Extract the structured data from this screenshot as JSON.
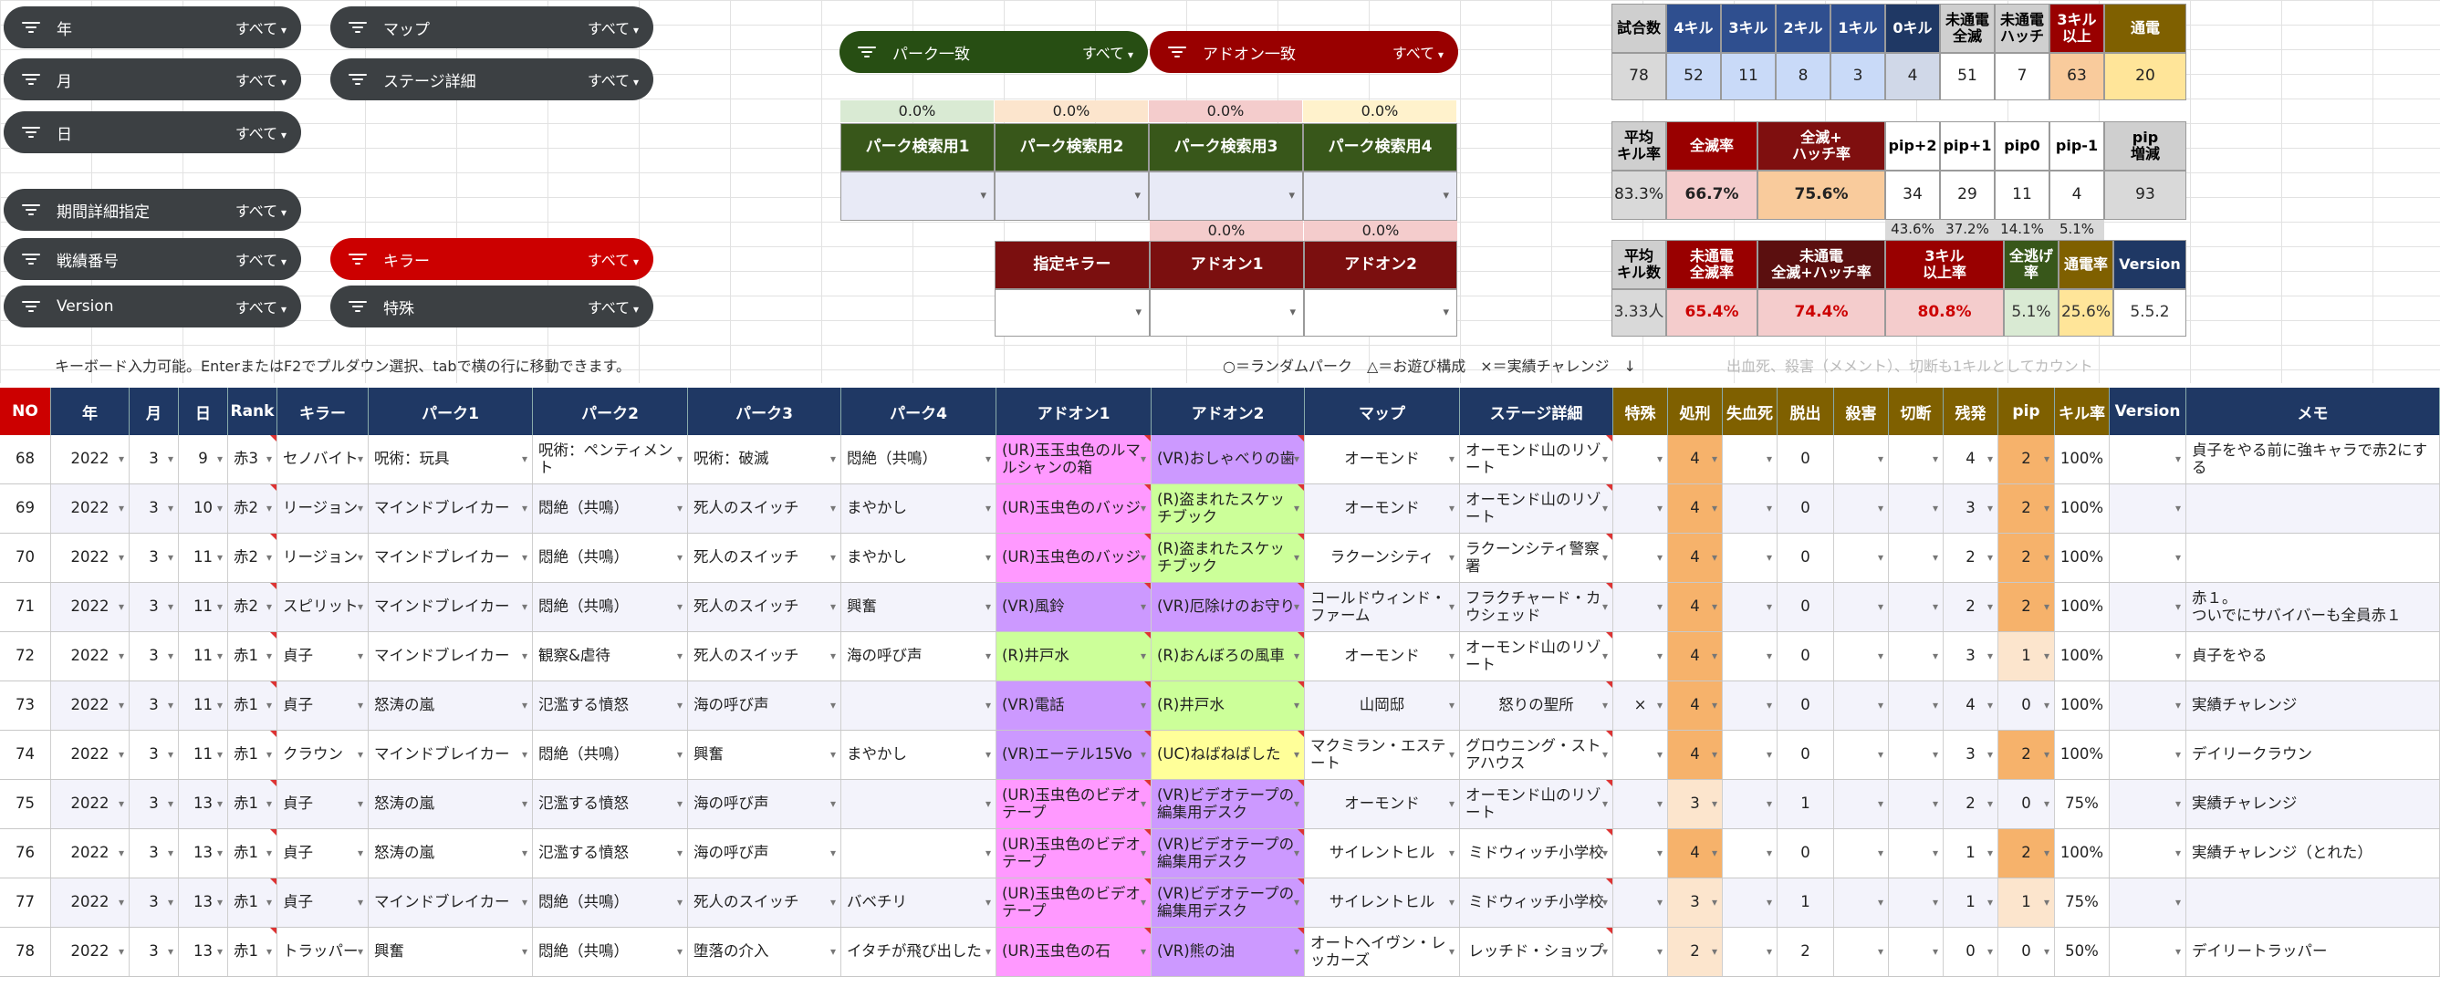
{
  "filters": {
    "year": {
      "label": "年",
      "value": "すべて"
    },
    "month": {
      "label": "月",
      "value": "すべて"
    },
    "day": {
      "label": "日",
      "value": "すべて"
    },
    "period": {
      "label": "期間詳細指定",
      "value": "すべて"
    },
    "record_no": {
      "label": "戦績番号",
      "value": "すべて"
    },
    "version": {
      "label": "Version",
      "value": "すべて"
    },
    "map": {
      "label": "マップ",
      "value": "すべて"
    },
    "stage": {
      "label": "ステージ詳細",
      "value": "すべて"
    },
    "killer": {
      "label": "キラー",
      "value": "すべて"
    },
    "special": {
      "label": "特殊",
      "value": "すべて"
    },
    "perk_match": {
      "label": "パーク一致",
      "value": "すべて"
    },
    "addon_match": {
      "label": "アドオン一致",
      "value": "すべて"
    }
  },
  "perk_search": {
    "percents": [
      "0.0%",
      "0.0%",
      "0.0%",
      "0.0%"
    ],
    "headers": [
      "パーク検索用1",
      "パーク検索用2",
      "パーク検索用3",
      "パーク検索用4"
    ],
    "addon_percents": [
      "0.0%",
      "0.0%"
    ],
    "killer_headers": [
      "指定キラー",
      "アドオン1",
      "アドオン2"
    ]
  },
  "stats1": {
    "headers": [
      "試合数",
      "4キル",
      "3キル",
      "2キル",
      "1キル",
      "0キル",
      "未通電\n全滅",
      "未通電\nハッチ",
      "3キル\n以上",
      "通電"
    ],
    "values": [
      "78",
      "52",
      "11",
      "8",
      "3",
      "4",
      "51",
      "7",
      "63",
      "20"
    ]
  },
  "stats2": {
    "headers": [
      "平均\nキル率",
      "全滅率",
      "全滅+\nハッチ率",
      "pip+2",
      "pip+1",
      "pip0",
      "pip-1",
      "pip\n増減"
    ],
    "values": [
      "83.3%",
      "66.7%",
      "75.6%",
      "34",
      "29",
      "11",
      "4",
      "93"
    ],
    "sub": [
      "43.6%",
      "37.2%",
      "14.1%",
      "5.1%"
    ]
  },
  "stats3": {
    "headers": [
      "平均\nキル数",
      "未通電\n全滅率",
      "未通電\n全滅+ハッチ率",
      "3キル\n以上率",
      "全逃げ\n率",
      "通電率",
      "Version"
    ],
    "values": [
      "3.33人",
      "65.4%",
      "74.4%",
      "80.8%",
      "5.1%",
      "25.6%",
      "5.5.2"
    ]
  },
  "notes": {
    "keyboard": "キーボード入力可能。EnterまたはF2でプルダウン選択、tabで横の行に移動できます。",
    "legend": "○＝ランダムパーク　△＝お遊び構成　×＝実績チャレンジ　↓",
    "count_note": "出血死、殺害（メメント）、切断も1キルとしてカウント"
  },
  "table": {
    "headers": [
      "NO",
      "年",
      "月",
      "日",
      "Rank",
      "キラー",
      "パーク1",
      "パーク2",
      "パーク3",
      "パーク4",
      "アドオン1",
      "アドオン2",
      "マップ",
      "ステージ詳細",
      "特殊",
      "処刑",
      "失血死",
      "脱出",
      "殺害",
      "切断",
      "残発",
      "pip",
      "キル率",
      "Version",
      "メモ"
    ],
    "rows": [
      [
        "68",
        "2022",
        "3",
        "9",
        "赤3",
        "セノバイト",
        "呪術：玩具",
        "呪術：ペンティメント",
        "呪術：破滅",
        "悶絶（共鳴）",
        "(UR)玉玉虫色のルマルシャンの箱",
        "(VR)おしゃべりの歯",
        "オーモンド",
        "オーモンド山のリゾート",
        "",
        "4",
        "",
        "0",
        "",
        "",
        "4",
        "2",
        "100%",
        "",
        "貞子をやる前に強キャラで赤2にする"
      ],
      [
        "69",
        "2022",
        "3",
        "10",
        "赤2",
        "リージョン",
        "マインドブレイカー",
        "悶絶（共鳴）",
        "死人のスイッチ",
        "まやかし",
        "(UR)玉虫色のバッジ",
        "(R)盗まれたスケッチブック",
        "オーモンド",
        "オーモンド山のリゾート",
        "",
        "4",
        "",
        "0",
        "",
        "",
        "3",
        "2",
        "100%",
        "",
        ""
      ],
      [
        "70",
        "2022",
        "3",
        "11",
        "赤2",
        "リージョン",
        "マインドブレイカー",
        "悶絶（共鳴）",
        "死人のスイッチ",
        "まやかし",
        "(UR)玉虫色のバッジ",
        "(R)盗まれたスケッチブック",
        "ラクーンシティ",
        "ラクーンシティ警察署",
        "",
        "4",
        "",
        "0",
        "",
        "",
        "2",
        "2",
        "100%",
        "",
        ""
      ],
      [
        "71",
        "2022",
        "3",
        "11",
        "赤2",
        "スピリット",
        "マインドブレイカー",
        "悶絶（共鳴）",
        "死人のスイッチ",
        "興奮",
        "(VR)風鈴",
        "(VR)厄除けのお守り",
        "コールドウィンド・ファーム",
        "フラクチャード・カウシェッド",
        "",
        "4",
        "",
        "0",
        "",
        "",
        "2",
        "2",
        "100%",
        "",
        "赤１。\nついでにサバイバーも全員赤１"
      ],
      [
        "72",
        "2022",
        "3",
        "11",
        "赤1",
        "貞子",
        "マインドブレイカー",
        "観察&虐待",
        "死人のスイッチ",
        "海の呼び声",
        "(R)井戸水",
        "(R)おんぼろの風車",
        "オーモンド",
        "オーモンド山のリゾート",
        "",
        "4",
        "",
        "0",
        "",
        "",
        "3",
        "1",
        "100%",
        "",
        "貞子をやる"
      ],
      [
        "73",
        "2022",
        "3",
        "11",
        "赤1",
        "貞子",
        "怒涛の嵐",
        "氾濫する憤怒",
        "海の呼び声",
        "",
        "(VR)電話",
        "(R)井戸水",
        "山岡邸",
        "怒りの聖所",
        "×",
        "4",
        "",
        "0",
        "",
        "",
        "4",
        "0",
        "100%",
        "",
        "実績チャレンジ"
      ],
      [
        "74",
        "2022",
        "3",
        "11",
        "赤1",
        "クラウン",
        "マインドブレイカー",
        "悶絶（共鳴）",
        "興奮",
        "まやかし",
        "(VR)エーテル15Vo",
        "(UC)ねばねばした",
        "マクミラン・エステート",
        "グロウニング・ストアハウス",
        "",
        "4",
        "",
        "0",
        "",
        "",
        "3",
        "2",
        "100%",
        "",
        "デイリークラウン"
      ],
      [
        "75",
        "2022",
        "3",
        "13",
        "赤1",
        "貞子",
        "怒涛の嵐",
        "氾濫する憤怒",
        "海の呼び声",
        "",
        "(UR)玉虫色のビデオテープ",
        "(VR)ビデオテープの編集用デスク",
        "オーモンド",
        "オーモンド山のリゾート",
        "",
        "3",
        "",
        "1",
        "",
        "",
        "2",
        "0",
        "75%",
        "",
        "実績チャレンジ"
      ],
      [
        "76",
        "2022",
        "3",
        "13",
        "赤1",
        "貞子",
        "怒涛の嵐",
        "氾濫する憤怒",
        "海の呼び声",
        "",
        "(UR)玉虫色のビデオテープ",
        "(VR)ビデオテープの編集用デスク",
        "サイレントヒル",
        "ミドウィッチ小学校",
        "",
        "4",
        "",
        "0",
        "",
        "",
        "1",
        "2",
        "100%",
        "",
        "実績チャレンジ（とれた）"
      ],
      [
        "77",
        "2022",
        "3",
        "13",
        "赤1",
        "貞子",
        "マインドブレイカー",
        "悶絶（共鳴）",
        "死人のスイッチ",
        "バベチリ",
        "(UR)玉虫色のビデオテープ",
        "(VR)ビデオテープの編集用デスク",
        "サイレントヒル",
        "ミドウィッチ小学校",
        "",
        "3",
        "",
        "1",
        "",
        "",
        "1",
        "1",
        "75%",
        "",
        ""
      ],
      [
        "78",
        "2022",
        "3",
        "13",
        "赤1",
        "トラッパー",
        "興奮",
        "悶絶（共鳴）",
        "堕落の介入",
        "イタチが飛び出した",
        "(UR)玉虫色の石",
        "(VR)熊の油",
        "オートヘイヴン・レッカーズ",
        "レッチド・ショップ",
        "",
        "2",
        "",
        "2",
        "",
        "",
        "0",
        "0",
        "50%",
        "",
        "デイリートラッパー"
      ]
    ]
  },
  "colors": {
    "dark_chip": "#3c4043",
    "red_chip": "#cc0000",
    "green_chip": "#274e13",
    "darkred_chip": "#990000",
    "navy": "#1f3864",
    "olive": "#7f6000",
    "addon_ur": "#ff99ff",
    "addon_vr": "#cc99ff",
    "addon_r": "#ccff99",
    "addon_uc": "#ffff99"
  }
}
